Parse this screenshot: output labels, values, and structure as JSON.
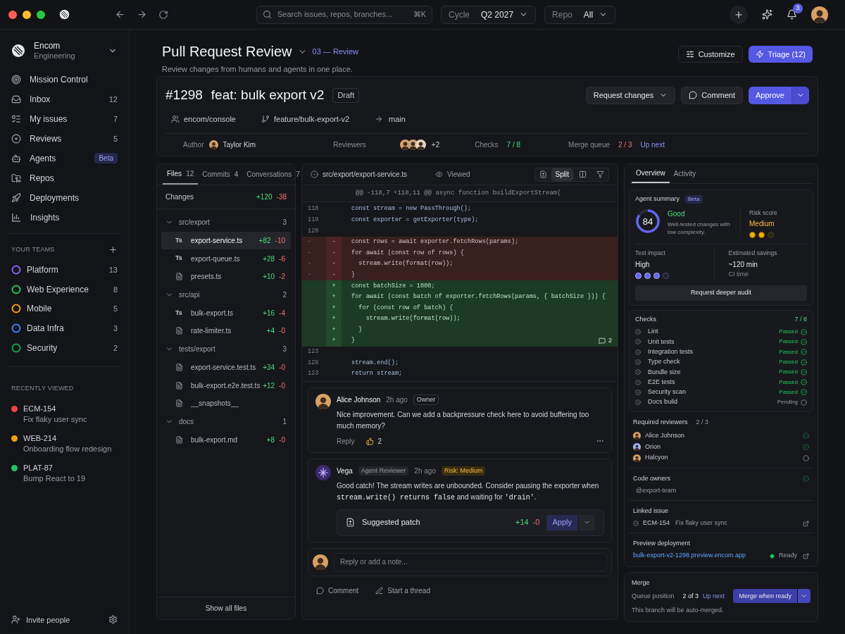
{
  "topbar": {
    "search_placeholder": "Search issues, repos, branches...",
    "shortcut": "⌘K",
    "filters": [
      {
        "label": "Cycle",
        "value": "Q2 2027"
      },
      {
        "label": "Repo",
        "value": "All"
      }
    ],
    "notifications": "3"
  },
  "workspace": {
    "name": "Encom",
    "team": "Engineering"
  },
  "nav": [
    {
      "label": "Mission Control"
    },
    {
      "label": "Inbox",
      "count": "12"
    },
    {
      "label": "My issues",
      "count": "7"
    },
    {
      "label": "Reviews",
      "count": "5"
    },
    {
      "label": "Agents",
      "badge": "Beta"
    },
    {
      "label": "Repos"
    },
    {
      "label": "Deployments"
    },
    {
      "label": "Insights"
    }
  ],
  "teams_heading": "YOUR TEAMS",
  "teams": [
    {
      "name": "Platform",
      "count": "13",
      "color": "#8b5cf6"
    },
    {
      "name": "Web Experience",
      "count": "8",
      "color": "#22c55e"
    },
    {
      "name": "Mobile",
      "count": "5",
      "color": "#f59e0b"
    },
    {
      "name": "Data Infra",
      "count": "3",
      "color": "#3b82f6"
    },
    {
      "name": "Security",
      "count": "2",
      "color": "#16a34a"
    }
  ],
  "recent_heading": "RECENTLY VIEWED",
  "recent": [
    {
      "id": "ECM-154",
      "title": "Fix flaky user sync",
      "color": "#ef4444"
    },
    {
      "id": "WEB-214",
      "title": "Onboarding flow redesign",
      "color": "#f59e0b"
    },
    {
      "id": "PLAT-87",
      "title": "Bump React to 19",
      "color": "#22c55e"
    }
  ],
  "invite": "Invite people",
  "page": {
    "title": "Pull Request Review",
    "step": "03 — Review",
    "subtitle": "Review changes from humans and agents in one place.",
    "customize": "Customize",
    "triage": "Triage (12)"
  },
  "pr": {
    "number": "#1298",
    "title": "feat: bulk export v2",
    "status": "Draft",
    "repo": "encom/console",
    "branch": "feature/bulk-export-v2",
    "target": "main",
    "request_changes": "Request changes",
    "comment": "Comment",
    "approve": "Approve",
    "author_label": "Author",
    "author": "Taylor Kim",
    "reviewers_label": "Reviewers",
    "reviewers_more": "+2",
    "checks_label": "Checks",
    "checks": "7 / 8",
    "queue_label": "Merge queue",
    "queue": "2 / 3",
    "queue_note": "Up next"
  },
  "files": {
    "tabs": [
      {
        "label": "Files",
        "count": "12",
        "selected": true
      },
      {
        "label": "Commits",
        "count": "4",
        "selected": false
      },
      {
        "label": "Conversations",
        "count": "7",
        "selected": false
      }
    ],
    "changes_label": "Changes",
    "additions": "+120",
    "deletions": "-38",
    "groups": [
      {
        "folder": "src/export",
        "count": "3",
        "expanded": true,
        "files": [
          {
            "tag": "Ts",
            "name": "export-service.ts",
            "additions": "+82",
            "deletions": "-10",
            "selected": true
          },
          {
            "tag": "Ts",
            "name": "export-queue.ts",
            "additions": "+28",
            "deletions": "-6",
            "selected": false
          },
          {
            "name": "presets.ts",
            "additions": "+10",
            "deletions": "-2",
            "selected": false
          }
        ]
      },
      {
        "folder": "src/api",
        "count": "2",
        "expanded": true,
        "files": [
          {
            "tag": "Ts",
            "name": "bulk-export.ts",
            "additions": "+16",
            "deletions": "-4",
            "selected": false
          },
          {
            "name": "rate-limiter.ts",
            "additions": "+4",
            "deletions": "-0",
            "selected": false
          }
        ]
      },
      {
        "folder": "tests/export",
        "count": "3",
        "expanded": true,
        "files": [
          {
            "name": "export-service.test.ts",
            "additions": "+34",
            "deletions": "-0",
            "selected": false
          },
          {
            "name": "bulk-export.e2e.test.ts",
            "additions": "+12",
            "deletions": "-0",
            "selected": false
          },
          {
            "name": "__snapshots__",
            "selected": false
          }
        ]
      },
      {
        "folder": "docs",
        "count": "1",
        "expanded": true,
        "files": [
          {
            "name": "bulk-export.md",
            "additions": "+8",
            "deletions": "-0",
            "selected": false
          }
        ]
      }
    ],
    "show_all": "Show all files"
  },
  "diff": {
    "path": "src/export/export-service.ts",
    "viewed": "Viewed",
    "split": "Split",
    "split_selected": true,
    "hunk": "@@ -118,7 +118,11 @@ async function buildExportStream(",
    "lines": [
      {
        "kind": "context",
        "old": "118",
        "code": "const stream = new PassThrough();"
      },
      {
        "kind": "context",
        "old": "119",
        "code": "const exporter = getExporter(type);"
      },
      {
        "kind": "context",
        "old": "120"
      },
      {
        "kind": "removed",
        "old": "-",
        "mark": "-",
        "code": "const rows = await exporter.fetchRows(params);"
      },
      {
        "kind": "removed",
        "old": "-",
        "mark": "-",
        "code": "for await (const row of rows) {"
      },
      {
        "kind": "removed",
        "old": "-",
        "mark": "-",
        "code": "  stream.write(format(row));"
      },
      {
        "kind": "removed",
        "old": "-",
        "mark": "-",
        "code": "}"
      },
      {
        "kind": "added",
        "mark": "+",
        "code": "const batchSize = 1000;"
      },
      {
        "kind": "added",
        "mark": "+",
        "code": "for await (const batch of exporter.fetchRows(params, { batchSize })) {"
      },
      {
        "kind": "added",
        "mark": "+",
        "code": "  for (const row of batch) {"
      },
      {
        "kind": "added",
        "mark": "+",
        "code": "    stream.write(format(row));"
      },
      {
        "kind": "added",
        "mark": "+",
        "code": "  }"
      },
      {
        "kind": "added",
        "mark": "+",
        "code": "}",
        "comments": "2"
      },
      {
        "kind": "context",
        "old": "123"
      },
      {
        "kind": "context",
        "old": "128",
        "code": "stream.end();"
      },
      {
        "kind": "context",
        "old": "123",
        "code": "return stream;"
      }
    ]
  },
  "comments": [
    {
      "kind": "human",
      "author": "Alice Johnson",
      "time": "2h ago",
      "role": "Owner",
      "segments": [
        {
          "text": "Nice improvement. Can we add a backpressure check here to avoid buffering too much memory?",
          "code": false
        }
      ],
      "reply": "Reply",
      "reactions": "2"
    },
    {
      "kind": "agent",
      "author": "Vega",
      "role": "Agent Reviewer",
      "time": "2h ago",
      "risk": "Risk: Medium",
      "segments": [
        {
          "text": "Good catch! The stream writes are unbounded. Consider pausing the exporter when ",
          "code": false
        },
        {
          "text": "stream.write() returns false",
          "code": true
        },
        {
          "text": " and waiting for ",
          "code": false
        },
        {
          "text": "'drain'",
          "code": true
        },
        {
          "text": ".",
          "code": false
        }
      ],
      "patch": {
        "label": "Suggested patch",
        "additions": "+14",
        "deletions": "-0",
        "action": "Apply"
      }
    }
  ],
  "reply_placeholder": "Reply or add a note...",
  "thread_actions": [
    "Comment",
    "Start a thread"
  ],
  "side": {
    "tabs": [
      {
        "label": "Overview",
        "selected": true
      },
      {
        "label": "Activity",
        "selected": false
      }
    ],
    "summary": {
      "title": "Agent summary",
      "badge": "Beta",
      "score": "84",
      "verdict": "Good",
      "verdict_text": "Well-tested changes with low complexity.",
      "risk_label": "Risk score",
      "risk": "Medium",
      "risk_dots": [
        {
          "on": true
        },
        {
          "on": true
        },
        {
          "on": false
        }
      ],
      "impact_label": "Test impact",
      "impact": "High",
      "impact_dots": [
        {
          "on": true
        },
        {
          "on": true
        },
        {
          "on": true
        },
        {
          "on": false
        }
      ],
      "savings_label": "Estimated savings",
      "savings": "~120 min",
      "savings_note": "CI time",
      "audit": "Request deeper audit"
    },
    "checks": {
      "title": "Checks",
      "count": "7 / 8",
      "items": [
        {
          "name": "Lint",
          "status": "Passed",
          "passed": true
        },
        {
          "name": "Unit tests",
          "status": "Passed",
          "passed": true
        },
        {
          "name": "Integration tests",
          "status": "Passed",
          "passed": true
        },
        {
          "name": "Type check",
          "status": "Passed",
          "passed": true
        },
        {
          "name": "Bundle size",
          "status": "Passed",
          "passed": true
        },
        {
          "name": "E2E tests",
          "status": "Passed",
          "passed": true
        },
        {
          "name": "Security scan",
          "status": "Passed",
          "passed": true
        },
        {
          "name": "Docs build",
          "status": "Pending",
          "passed": false
        }
      ]
    },
    "reviewers": {
      "title": "Required reviewers",
      "count": "2 / 3",
      "items": [
        {
          "name": "Alice Johnson",
          "approved": true
        },
        {
          "name": "Orion",
          "approved": true
        },
        {
          "name": "Halcyon",
          "approved": false
        }
      ]
    },
    "owners": {
      "title": "Code owners",
      "approved": true,
      "team": "@export-team"
    },
    "issue": {
      "title": "Linked issue",
      "id": "ECM-154",
      "name": "Fix flaky user sync"
    },
    "preview": {
      "title": "Preview deployment",
      "url": "bulk-export-v2-1298.preview.encom.app",
      "status": "Ready"
    },
    "merge": {
      "title": "Merge",
      "queue_label": "Queue position",
      "position": "2 of 3",
      "note": "Up next",
      "button": "Merge when ready",
      "info": "This branch will be auto-merged."
    }
  }
}
